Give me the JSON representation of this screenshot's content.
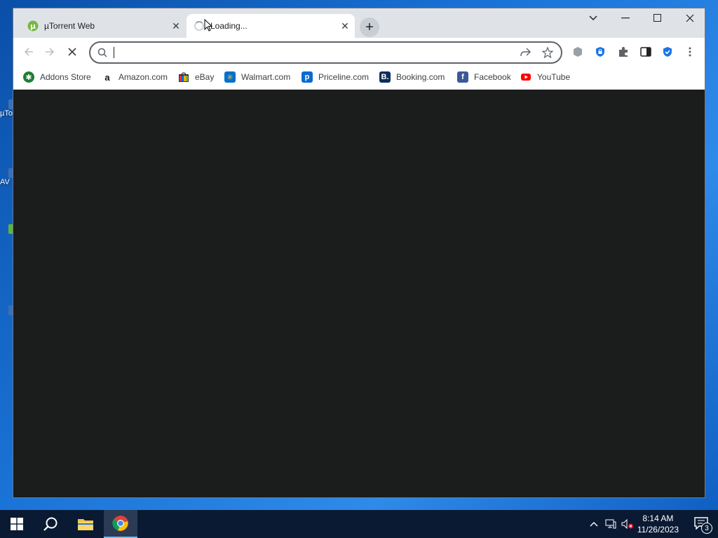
{
  "desktop": {
    "icons": [
      {
        "label": "µTo"
      },
      {
        "label": "AV"
      },
      {
        "label": ""
      },
      {
        "label": ""
      }
    ]
  },
  "browser": {
    "tabs": [
      {
        "title": "µTorrent Web",
        "state": "loaded"
      },
      {
        "title": "Loading...",
        "state": "loading"
      }
    ],
    "omnibox": {
      "value": "",
      "placeholder": ""
    },
    "bookmarks": [
      {
        "label": "Addons Store",
        "icon": "addons-store-icon",
        "color": "#1e7e34"
      },
      {
        "label": "Amazon.com",
        "icon": "amazon-icon",
        "color": "#ffffff"
      },
      {
        "label": "eBay",
        "icon": "ebay-icon",
        "color": "#e53238"
      },
      {
        "label": "Walmart.com",
        "icon": "walmart-icon",
        "color": "#0071ce"
      },
      {
        "label": "Priceline.com",
        "icon": "priceline-icon",
        "color": "#0a6ad1"
      },
      {
        "label": "Booking.com",
        "icon": "booking-icon",
        "color": "#0c2d5c"
      },
      {
        "label": "Facebook",
        "icon": "facebook-icon",
        "color": "#3b5998"
      },
      {
        "label": "YouTube",
        "icon": "youtube-icon",
        "color": "#ff0000"
      }
    ]
  },
  "taskbar": {
    "time": "8:14 AM",
    "date": "11/26/2023",
    "notification_count": "3"
  }
}
